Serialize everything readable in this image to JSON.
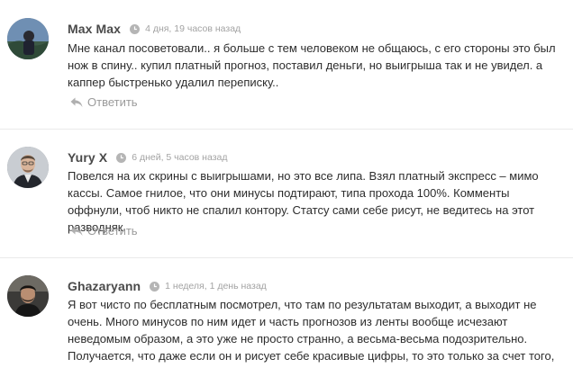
{
  "comments": [
    {
      "author": "Max Max",
      "time": "4 дня, 19 часов назад",
      "text": "Мне канал посоветовали.. я больше с тем человеком не общаюсь, с его стороны это был нож в спину.. купил платный прогноз, поставил деньги, но выигрыша так и не увидел. а каппер быстренько удалил переписку..",
      "reply_label": "Ответить",
      "avatar_icon": "avatar-photo"
    },
    {
      "author": "Yury X",
      "time": "6 дней, 5 часов назад",
      "text": "Повелся на их скрины с выигрышами, но это все липа. Взял платный экспресс – мимо кассы. Самое гнилое, что они минусы подтирают, типа прохода 100%. Комменты оффнули, чтоб никто не спалил контору. Статсу сами себе рисут, не ведитесь на этот разводняк.",
      "reply_label": "Ответить",
      "avatar_icon": "avatar-photo"
    },
    {
      "author": "Ghazaryann",
      "time": "1 неделя, 1 день назад",
      "text": "Я вот чисто по бесплатным посмотрел, что там по результатам выходит, а выходит не очень. Много минусов по ним идет и часть прогнозов из ленты вообще исчезают неведомым образом, а это уже не просто странно, а весьма-весьма подозрительно. Получается, что даже если он и рисует себе красивые цифры, то это только за счет того, что часть ставок вообще не входит в эти все подсчеты.",
      "reply_label": "",
      "avatar_icon": "avatar-photo"
    }
  ],
  "icons": {
    "time": "clock-icon",
    "reply": "reply-arrow-icon"
  },
  "colors": {
    "author": "#4a4a4a",
    "meta": "#a3a3a3",
    "body_text": "#2d2d2d",
    "reply": "#9b9b9b",
    "divider": "#eaeaea"
  }
}
